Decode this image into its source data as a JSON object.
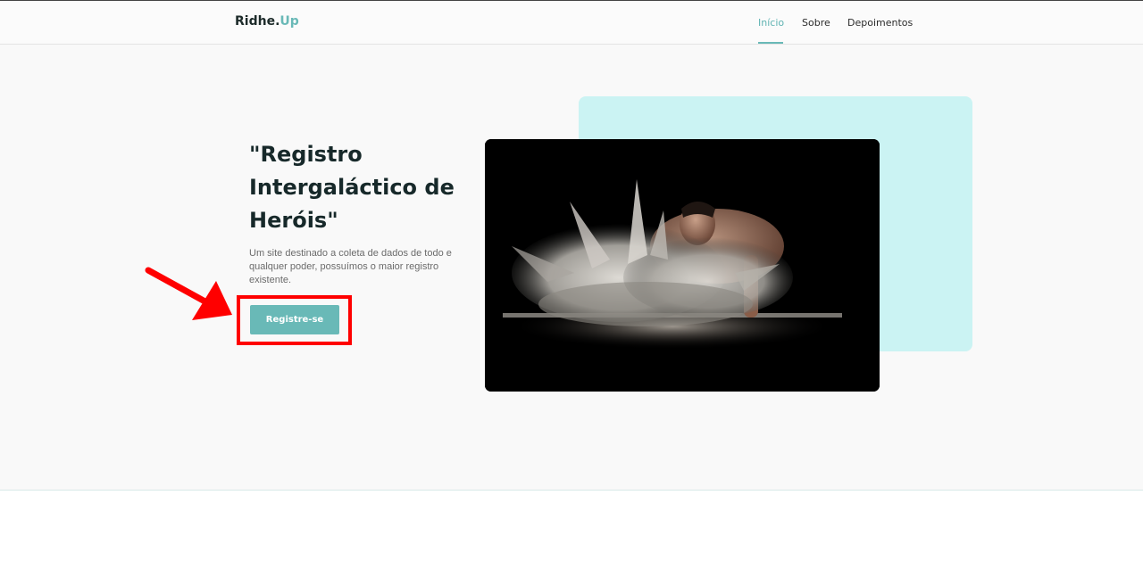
{
  "header": {
    "logo_main": "Ridhe.",
    "logo_accent": "Up",
    "nav": [
      {
        "label": "Início",
        "active": true
      },
      {
        "label": "Sobre",
        "active": false
      },
      {
        "label": "Depoimentos",
        "active": false
      }
    ]
  },
  "hero": {
    "title": "\"Registro Intergaláctico de Heróis\"",
    "description": "Um site destinado a coleta de dados de todo e qualquer poder, possuímos o maior registro existente.",
    "cta_label": "Registre-se",
    "image_alt": "man exploding in white powder"
  },
  "annotation": {
    "arrow_color": "#ff0000",
    "highlight_color": "#ff0000"
  },
  "colors": {
    "accent": "#69b9b7",
    "card": "#cbf3f3",
    "title": "#17292a"
  }
}
